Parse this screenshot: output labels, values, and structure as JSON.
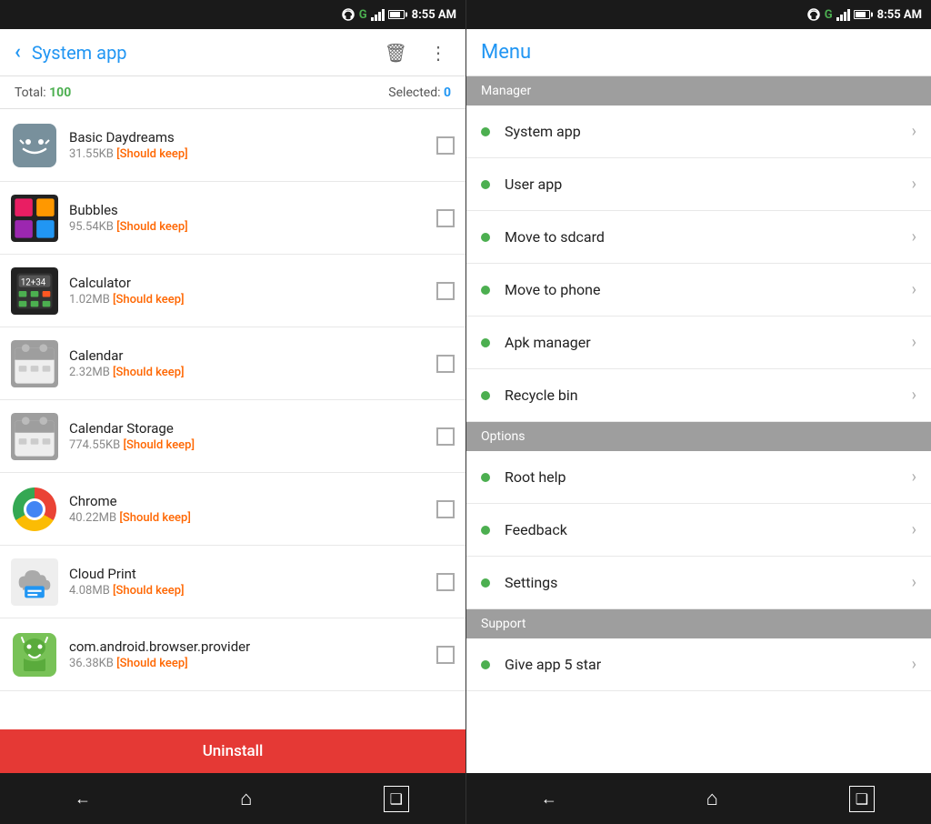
{
  "leftPanel": {
    "statusBar": {
      "time": "8:55 AM"
    },
    "appBar": {
      "backLabel": "‹",
      "title": "System app",
      "deleteIcon": "🗑",
      "moreIcon": "⋮"
    },
    "stats": {
      "totalLabel": "Total:",
      "totalCount": "100",
      "selectedLabel": "Selected:",
      "selectedCount": "0"
    },
    "apps": [
      {
        "name": "Basic Daydreams",
        "size": "31.55KB",
        "keep": "[Should keep]"
      },
      {
        "name": "Bubbles",
        "size": "95.54KB",
        "keep": "[Should keep]"
      },
      {
        "name": "Calculator",
        "size": "1.02MB",
        "keep": "[Should keep]"
      },
      {
        "name": "Calendar",
        "size": "2.32MB",
        "keep": "[Should keep]"
      },
      {
        "name": "Calendar Storage",
        "size": "774.55KB",
        "keep": "[Should keep]"
      },
      {
        "name": "Chrome",
        "size": "40.22MB",
        "keep": "[Should keep]"
      },
      {
        "name": "Cloud Print",
        "size": "4.08MB",
        "keep": "[Should keep]"
      },
      {
        "name": "com.android.browser.provider",
        "size": "36.38KB",
        "keep": "[Should keep]"
      }
    ],
    "uninstallLabel": "Uninstall"
  },
  "menuPanel": {
    "statusBar": {
      "time": "8:55 AM"
    },
    "appBar": {
      "title": "Menu"
    },
    "sections": [
      {
        "header": "Manager",
        "items": [
          {
            "label": "System app"
          },
          {
            "label": "User app"
          },
          {
            "label": "Move to sdcard"
          },
          {
            "label": "Move to phone"
          },
          {
            "label": "Apk manager"
          },
          {
            "label": "Recycle bin"
          }
        ]
      },
      {
        "header": "Options",
        "items": [
          {
            "label": "Root help"
          },
          {
            "label": "Feedback"
          },
          {
            "label": "Settings"
          }
        ]
      },
      {
        "header": "Support",
        "items": [
          {
            "label": "Give app 5 star"
          }
        ]
      }
    ]
  },
  "nav": {
    "backLabel": "←",
    "homeLabel": "⌂",
    "recentLabel": "❑"
  }
}
